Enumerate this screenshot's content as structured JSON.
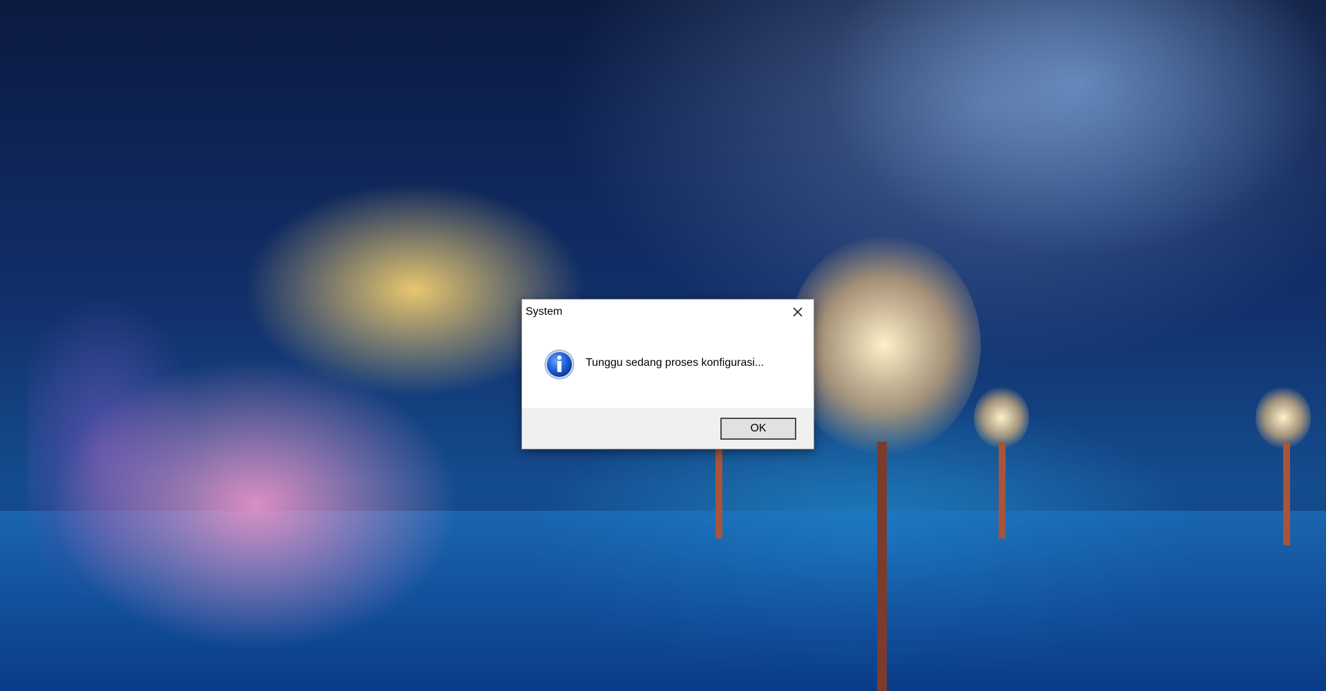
{
  "wallpaper": {
    "description_icon": "anime-night-lantern-wallpaper"
  },
  "dialog": {
    "title": "System",
    "message": "Tunggu sedang proses konfigurasi...",
    "ok_label": "OK",
    "icon": "info-icon",
    "close_icon": "close-icon"
  }
}
